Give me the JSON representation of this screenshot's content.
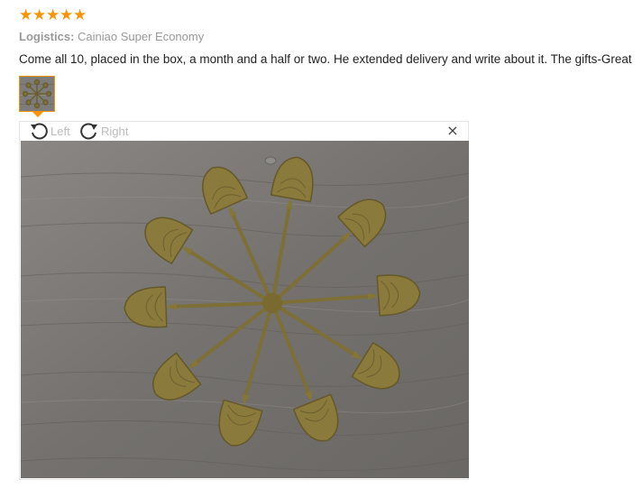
{
  "rating": {
    "stars": 5,
    "max": 5,
    "star_glyph": "★",
    "color": "#f89406"
  },
  "logistics": {
    "label": "Logistics:",
    "value": "Cainiao Super Economy"
  },
  "comment": {
    "text": "Come all 10, placed in the box, a month and a half or two. He extended delivery and write about it. The gifts-Great"
  },
  "thumbnail": {
    "selected": true,
    "border_color": "#f89406"
  },
  "viewer": {
    "rotate_left_label": "Left",
    "rotate_right_label": "Right",
    "close_glyph": "×",
    "rotate_left_icon": "rotate-left-icon",
    "rotate_right_icon": "rotate-right-icon",
    "close_icon": "close-icon"
  }
}
